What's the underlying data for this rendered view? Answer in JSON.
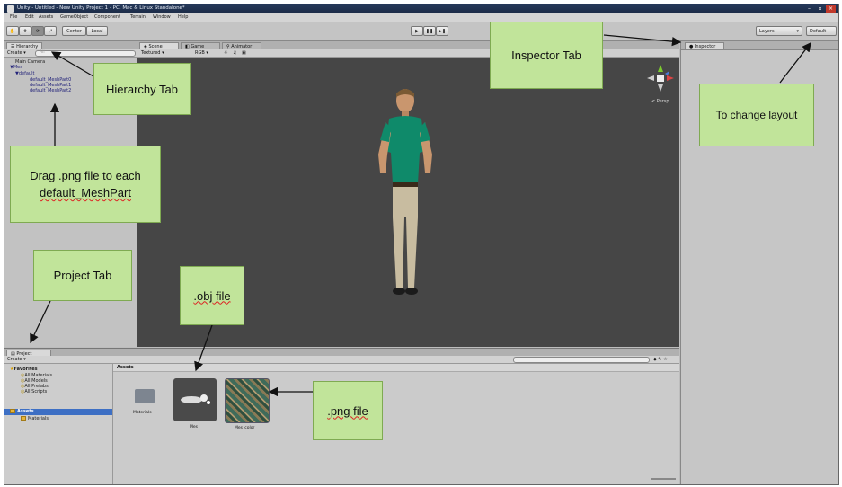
{
  "window": {
    "title": "Unity - Untitled - New Unity Project 1 - PC, Mac & Linux Standalone*"
  },
  "menu": [
    "File",
    "Edit",
    "Assets",
    "GameObject",
    "Component",
    "Terrain",
    "Window",
    "Help"
  ],
  "toolbar": {
    "pivot_label": "Center",
    "space_label": "Local",
    "layers_label": "Layers",
    "layout_label": "Default"
  },
  "hierarchy": {
    "tab_label": "Hierarchy",
    "create_label": "Create",
    "search_placeholder": "All",
    "items": [
      "Main Camera",
      "Mes",
      "default",
      "default_MeshPart0",
      "default_MeshPart1",
      "default_MeshPart2"
    ]
  },
  "scene": {
    "tabs": [
      "Scene",
      "Game",
      "Animator"
    ],
    "render_mode": "Textured",
    "color_mode": "RGB",
    "gizmo_label": "< Persp"
  },
  "inspector": {
    "tab_label": "Inspector"
  },
  "project": {
    "tab_label": "Project",
    "create_label": "Create",
    "breadcrumb": "Assets",
    "favorites_label": "Favorites",
    "favorites": [
      "All Materials",
      "All Models",
      "All Prefabs",
      "All Scripts"
    ],
    "assets_label": "Assets",
    "folders": [
      "Materials"
    ],
    "asset_tiles": [
      "Materials",
      "Mes",
      "Mes_color"
    ]
  },
  "callouts": {
    "hierarchy_tab": "Hierarchy Tab",
    "inspector_tab": "Inspector Tab",
    "change_layout": "To change layout",
    "drag_png_line1": "Drag .png file to each",
    "drag_png_line2": "default_MeshPart",
    "project_tab": "Project Tab",
    "obj_file": ".obj file",
    "png_file": ".png file"
  },
  "colors": {
    "callout_fill": "#c1e49a",
    "scene_bg": "#464646",
    "title_bar": "#1c2b46",
    "selection": "#3d6fc4"
  }
}
